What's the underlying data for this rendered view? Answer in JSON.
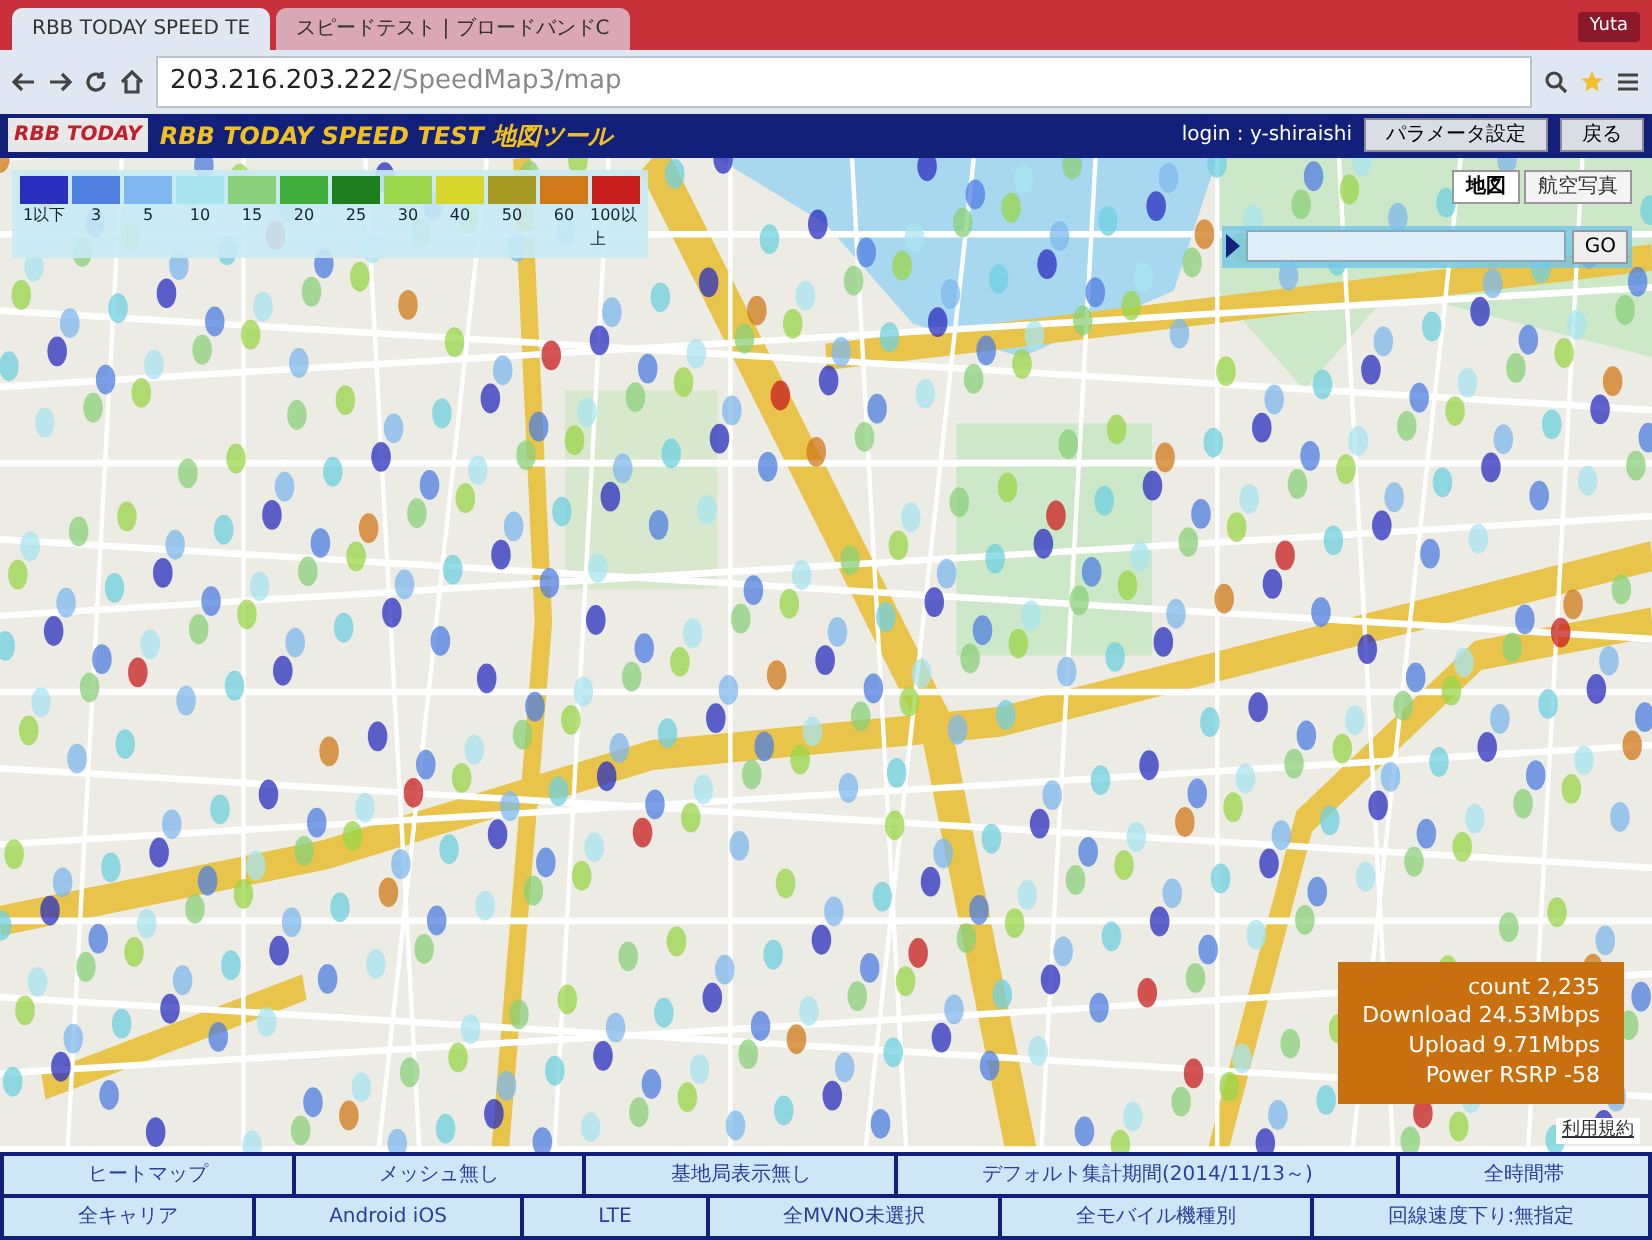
{
  "browser": {
    "tabs": [
      {
        "label": "RBB TODAY SPEED TE",
        "selected": true
      },
      {
        "label": "スピードテスト | ブロードバンドC",
        "selected": false
      }
    ],
    "profile": "Yuta",
    "url_host": "203.216.203.222",
    "url_path": "/SpeedMap3/map"
  },
  "header": {
    "logo": "RBB TODAY",
    "title": "RBB TODAY SPEED TEST 地図ツール",
    "login": "login : y-shiraishi",
    "buttons": [
      "パラメータ設定",
      "戻る"
    ]
  },
  "map": {
    "legend": [
      {
        "color": "#2a2fc0",
        "label": "1以下"
      },
      {
        "color": "#4f7fe0",
        "label": "3"
      },
      {
        "color": "#7fb8ee",
        "label": "5"
      },
      {
        "color": "#a8e4f0",
        "label": "10"
      },
      {
        "color": "#8ad07a",
        "label": "15"
      },
      {
        "color": "#3fae3a",
        "label": "20"
      },
      {
        "color": "#1f7f1f",
        "label": "25"
      },
      {
        "color": "#9ad64a",
        "label": "30"
      },
      {
        "color": "#d6d62a",
        "label": "40"
      },
      {
        "color": "#a69a22",
        "label": "50"
      },
      {
        "color": "#d07a1a",
        "label": "60"
      },
      {
        "color": "#c81e1e",
        "label": "100以上"
      }
    ],
    "map_types": [
      {
        "label": "地図",
        "selected": true
      },
      {
        "label": "航空写真",
        "selected": false
      }
    ],
    "search": {
      "button": "GO"
    },
    "stats": [
      "count 2,235",
      "Download 24.53Mbps",
      "Upload 9.71Mbps",
      "Power RSRP -58"
    ],
    "terms": "利用規約"
  },
  "settings": [
    [
      "ヒートマップ",
      "メッシュ無し",
      "基地局表示無し",
      "デフォルト集計期間(2014/11/13～)",
      "全時間帯"
    ],
    [
      "全キャリア",
      "Android iOS",
      "LTE",
      "全MVNO未選択",
      "全モバイル機種別",
      "回線速度下り:無指定"
    ]
  ]
}
